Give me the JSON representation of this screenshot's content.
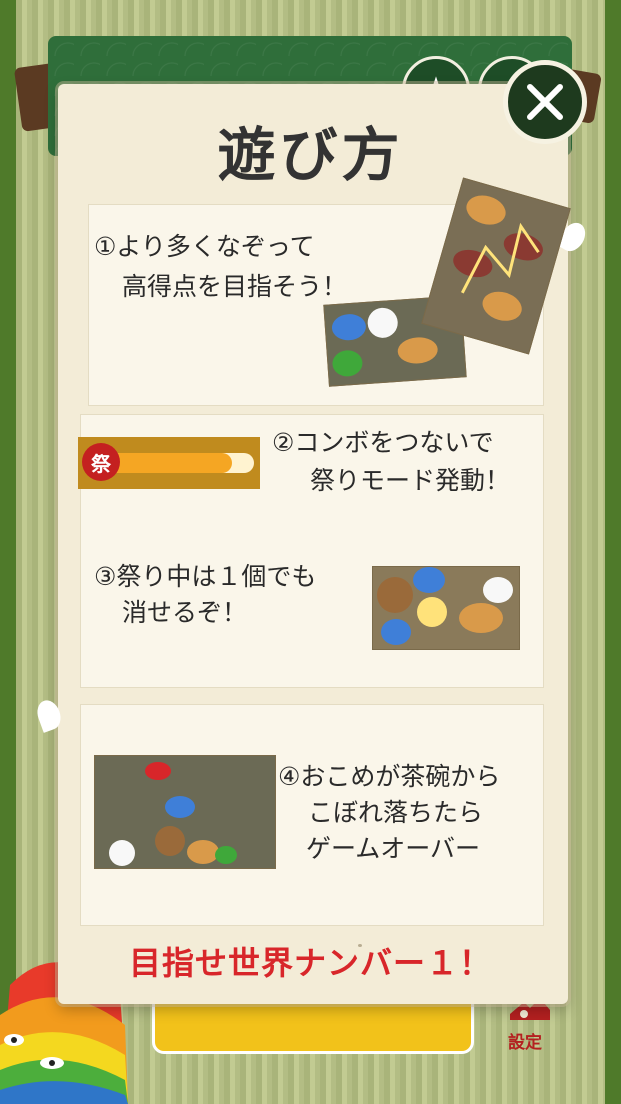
{
  "title": "遊び方",
  "steps": {
    "s1": {
      "line1": "①より多くなぞって",
      "line2": "高得点を目指そう！"
    },
    "s2": {
      "line1": "②コンボをつないで",
      "line2": "祭りモード発動！",
      "gauge_badge": "祭"
    },
    "s3": {
      "line1": "③祭り中は１個でも",
      "line2": "消せるぞ！"
    },
    "s4": {
      "line1": "④おこめが茶碗から",
      "line2": "こぼれ落ちたら",
      "line3": "ゲームオーバー"
    }
  },
  "slogan": "目指せ世界ナンバー１！",
  "settings_label": "設定",
  "colors": {
    "slogan": "#d8262a",
    "header_green": "#2f6e3a",
    "close_bg": "#1e3a1e",
    "gauge": "#f5a623"
  }
}
